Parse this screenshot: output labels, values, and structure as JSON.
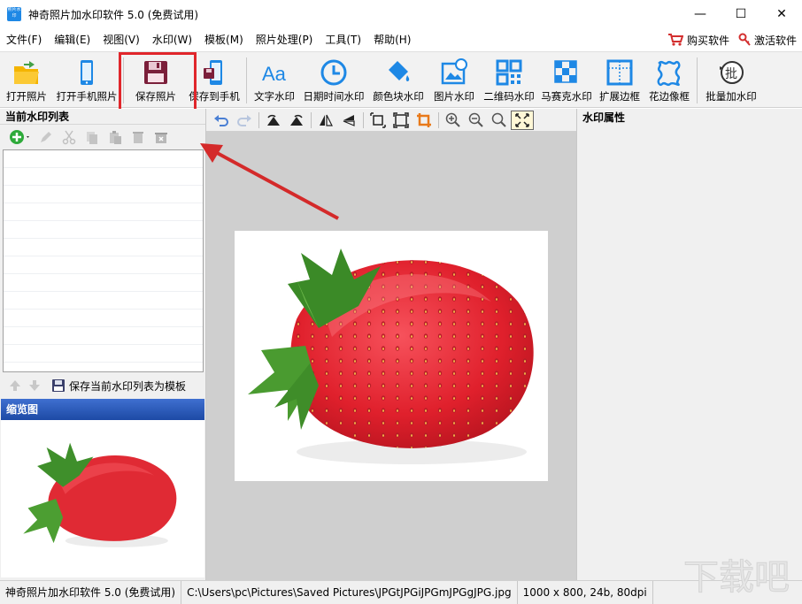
{
  "window": {
    "title": "神奇照片加水印软件 5.0 (免费试用)",
    "app_icon_text": "照片水印",
    "minimize": "—",
    "maximize": "☐",
    "close": "✕"
  },
  "menu": {
    "items": [
      "文件(F)",
      "编辑(E)",
      "视图(V)",
      "水印(W)",
      "模板(M)",
      "照片处理(P)",
      "工具(T)",
      "帮助(H)"
    ],
    "buy": "购买软件",
    "activate": "激活软件"
  },
  "toolbar": {
    "open_photo": "打开照片",
    "open_phone_photo": "打开手机照片",
    "save_photo": "保存照片",
    "save_to_phone": "保存到手机",
    "text_watermark": "文字水印",
    "datetime_watermark": "日期时间水印",
    "color_block_watermark": "颜色块水印",
    "image_watermark": "图片水印",
    "qrcode_watermark": "二维码水印",
    "mosaic_watermark": "马赛克水印",
    "expand_border": "扩展边框",
    "lace_border": "花边像框",
    "batch_watermark": "批量加水印",
    "text_icon_glyph": "Aa",
    "batch_icon_glyph": "批"
  },
  "left_panel": {
    "watermark_list_title": "当前水印列表",
    "save_template_label": "保存当前水印列表为模板",
    "thumbnail_title": "缩览图"
  },
  "right_panel": {
    "title": "水印属性"
  },
  "statusbar": {
    "app_name": "神奇照片加水印软件 5.0 (免费试用)",
    "file_path": "C:\\Users\\pc\\Pictures\\Saved Pictures\\JPGtJPGiJPGmJPGgJPG.jpg",
    "image_info": "1000 x 800, 24b, 80dpi"
  },
  "watermark_logo": "下载吧",
  "colors": {
    "highlight": "#e0262b",
    "arrow": "#d42a2a",
    "thumb_header": "#2b5bbd",
    "strawberry": "#e8303c"
  }
}
